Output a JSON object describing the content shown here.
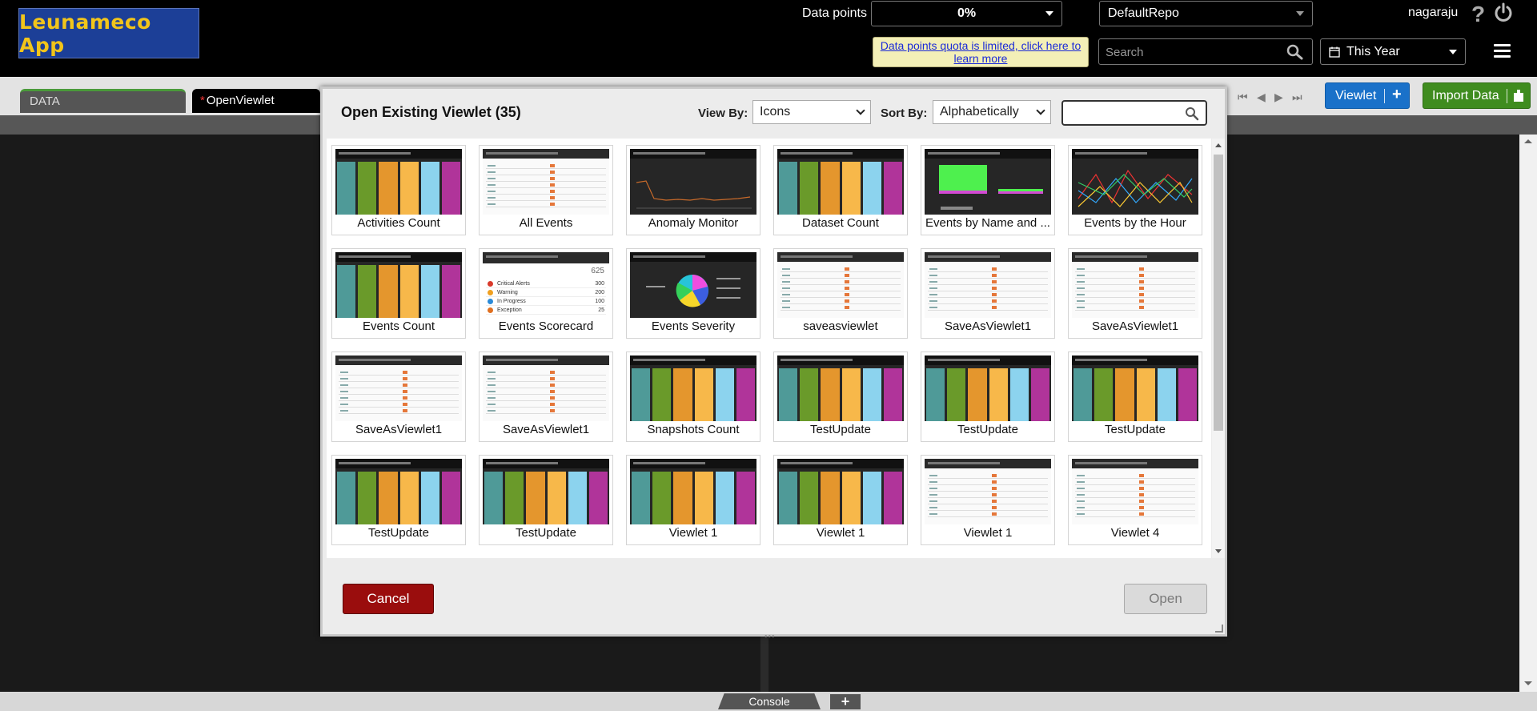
{
  "header": {
    "logo_text": "Leunameco App",
    "data_points_label": "Data points",
    "data_points_value": "0%",
    "repo_value": "DefaultRepo",
    "quota_text": "Data points quota is limited, click here to learn more",
    "search_placeholder": "Search",
    "date_range": "This Year",
    "username": "nagaraju",
    "help_glyph": "?"
  },
  "tabs": {
    "data_label": "DATA",
    "open_label": "OpenViewlet",
    "open_modified": "*"
  },
  "toolbar": {
    "viewlet_label": "Viewlet",
    "viewlet_plus": "+",
    "import_label": "Import Data"
  },
  "modal": {
    "title": "Open Existing Viewlet (35)",
    "view_by_label": "View By:",
    "view_by_value": "Icons",
    "sort_by_label": "Sort By:",
    "sort_by_value": "Alphabetically",
    "filter_value": "",
    "cancel_label": "Cancel",
    "open_label": "Open",
    "items": [
      {
        "name": "Activities Count",
        "thumb": "bars"
      },
      {
        "name": "All Events",
        "thumb": "table"
      },
      {
        "name": "Anomaly Monitor",
        "thumb": "line"
      },
      {
        "name": "Dataset Count",
        "thumb": "bars"
      },
      {
        "name": "Events by Name and ...",
        "thumb": "green"
      },
      {
        "name": "Events by the Hour",
        "thumb": "multiline"
      },
      {
        "name": "Events Count",
        "thumb": "bars"
      },
      {
        "name": "Events Scorecard",
        "thumb": "score"
      },
      {
        "name": "Events Severity",
        "thumb": "pie"
      },
      {
        "name": "saveasviewlet",
        "thumb": "table"
      },
      {
        "name": "SaveAsViewlet1",
        "thumb": "table"
      },
      {
        "name": "SaveAsViewlet1",
        "thumb": "table"
      },
      {
        "name": "SaveAsViewlet1",
        "thumb": "table"
      },
      {
        "name": "SaveAsViewlet1",
        "thumb": "table"
      },
      {
        "name": "Snapshots Count",
        "thumb": "bars"
      },
      {
        "name": "TestUpdate",
        "thumb": "bars"
      },
      {
        "name": "TestUpdate",
        "thumb": "bars"
      },
      {
        "name": "TestUpdate",
        "thumb": "bars"
      },
      {
        "name": "TestUpdate",
        "thumb": "bars"
      },
      {
        "name": "TestUpdate",
        "thumb": "bars"
      },
      {
        "name": "Viewlet 1",
        "thumb": "bars"
      },
      {
        "name": "Viewlet 1",
        "thumb": "bars"
      },
      {
        "name": "Viewlet 1",
        "thumb": "table"
      },
      {
        "name": "Viewlet 4",
        "thumb": "table"
      },
      {
        "name": "",
        "thumb": "partial"
      },
      {
        "name": "",
        "thumb": "partial"
      },
      {
        "name": "",
        "thumb": "partial"
      },
      {
        "name": "",
        "thumb": "partial"
      },
      {
        "name": "",
        "thumb": "partial"
      },
      {
        "name": "",
        "thumb": "partial"
      }
    ],
    "scorecard": {
      "total": "625",
      "rows": [
        {
          "label": "Critical Alerts",
          "value": "300",
          "color": "#d93a2b"
        },
        {
          "label": "Warning",
          "value": "200",
          "color": "#f0a020"
        },
        {
          "label": "In Progress",
          "value": "100",
          "color": "#2a8ad8"
        },
        {
          "label": "Exception",
          "value": "25",
          "color": "#e07020"
        }
      ]
    }
  },
  "bar_colors": [
    "#4f9a98",
    "#6a9a2a",
    "#e4962d",
    "#f7b84a",
    "#8cd3ee",
    "#b0349a"
  ],
  "console": {
    "label": "Console",
    "add": "+"
  }
}
